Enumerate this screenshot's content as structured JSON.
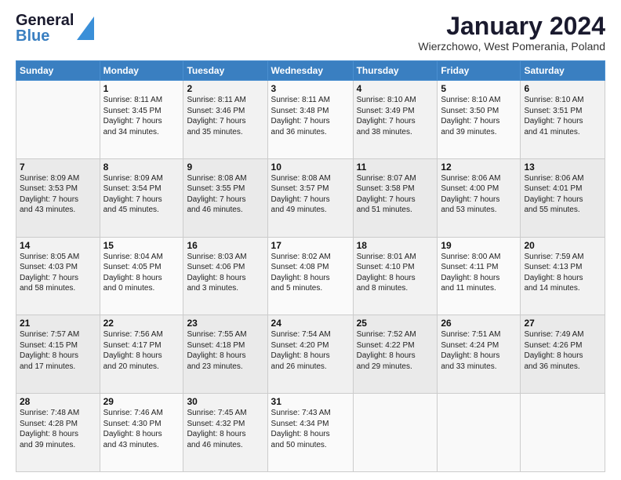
{
  "header": {
    "logo_line1": "General",
    "logo_line2": "Blue",
    "month_title": "January 2024",
    "location": "Wierzchowo, West Pomerania, Poland"
  },
  "weekdays": [
    "Sunday",
    "Monday",
    "Tuesday",
    "Wednesday",
    "Thursday",
    "Friday",
    "Saturday"
  ],
  "weeks": [
    [
      {
        "day": "",
        "info": ""
      },
      {
        "day": "1",
        "info": "Sunrise: 8:11 AM\nSunset: 3:45 PM\nDaylight: 7 hours\nand 34 minutes."
      },
      {
        "day": "2",
        "info": "Sunrise: 8:11 AM\nSunset: 3:46 PM\nDaylight: 7 hours\nand 35 minutes."
      },
      {
        "day": "3",
        "info": "Sunrise: 8:11 AM\nSunset: 3:48 PM\nDaylight: 7 hours\nand 36 minutes."
      },
      {
        "day": "4",
        "info": "Sunrise: 8:10 AM\nSunset: 3:49 PM\nDaylight: 7 hours\nand 38 minutes."
      },
      {
        "day": "5",
        "info": "Sunrise: 8:10 AM\nSunset: 3:50 PM\nDaylight: 7 hours\nand 39 minutes."
      },
      {
        "day": "6",
        "info": "Sunrise: 8:10 AM\nSunset: 3:51 PM\nDaylight: 7 hours\nand 41 minutes."
      }
    ],
    [
      {
        "day": "7",
        "info": "Sunrise: 8:09 AM\nSunset: 3:53 PM\nDaylight: 7 hours\nand 43 minutes."
      },
      {
        "day": "8",
        "info": "Sunrise: 8:09 AM\nSunset: 3:54 PM\nDaylight: 7 hours\nand 45 minutes."
      },
      {
        "day": "9",
        "info": "Sunrise: 8:08 AM\nSunset: 3:55 PM\nDaylight: 7 hours\nand 46 minutes."
      },
      {
        "day": "10",
        "info": "Sunrise: 8:08 AM\nSunset: 3:57 PM\nDaylight: 7 hours\nand 49 minutes."
      },
      {
        "day": "11",
        "info": "Sunrise: 8:07 AM\nSunset: 3:58 PM\nDaylight: 7 hours\nand 51 minutes."
      },
      {
        "day": "12",
        "info": "Sunrise: 8:06 AM\nSunset: 4:00 PM\nDaylight: 7 hours\nand 53 minutes."
      },
      {
        "day": "13",
        "info": "Sunrise: 8:06 AM\nSunset: 4:01 PM\nDaylight: 7 hours\nand 55 minutes."
      }
    ],
    [
      {
        "day": "14",
        "info": "Sunrise: 8:05 AM\nSunset: 4:03 PM\nDaylight: 7 hours\nand 58 minutes."
      },
      {
        "day": "15",
        "info": "Sunrise: 8:04 AM\nSunset: 4:05 PM\nDaylight: 8 hours\nand 0 minutes."
      },
      {
        "day": "16",
        "info": "Sunrise: 8:03 AM\nSunset: 4:06 PM\nDaylight: 8 hours\nand 3 minutes."
      },
      {
        "day": "17",
        "info": "Sunrise: 8:02 AM\nSunset: 4:08 PM\nDaylight: 8 hours\nand 5 minutes."
      },
      {
        "day": "18",
        "info": "Sunrise: 8:01 AM\nSunset: 4:10 PM\nDaylight: 8 hours\nand 8 minutes."
      },
      {
        "day": "19",
        "info": "Sunrise: 8:00 AM\nSunset: 4:11 PM\nDaylight: 8 hours\nand 11 minutes."
      },
      {
        "day": "20",
        "info": "Sunrise: 7:59 AM\nSunset: 4:13 PM\nDaylight: 8 hours\nand 14 minutes."
      }
    ],
    [
      {
        "day": "21",
        "info": "Sunrise: 7:57 AM\nSunset: 4:15 PM\nDaylight: 8 hours\nand 17 minutes."
      },
      {
        "day": "22",
        "info": "Sunrise: 7:56 AM\nSunset: 4:17 PM\nDaylight: 8 hours\nand 20 minutes."
      },
      {
        "day": "23",
        "info": "Sunrise: 7:55 AM\nSunset: 4:18 PM\nDaylight: 8 hours\nand 23 minutes."
      },
      {
        "day": "24",
        "info": "Sunrise: 7:54 AM\nSunset: 4:20 PM\nDaylight: 8 hours\nand 26 minutes."
      },
      {
        "day": "25",
        "info": "Sunrise: 7:52 AM\nSunset: 4:22 PM\nDaylight: 8 hours\nand 29 minutes."
      },
      {
        "day": "26",
        "info": "Sunrise: 7:51 AM\nSunset: 4:24 PM\nDaylight: 8 hours\nand 33 minutes."
      },
      {
        "day": "27",
        "info": "Sunrise: 7:49 AM\nSunset: 4:26 PM\nDaylight: 8 hours\nand 36 minutes."
      }
    ],
    [
      {
        "day": "28",
        "info": "Sunrise: 7:48 AM\nSunset: 4:28 PM\nDaylight: 8 hours\nand 39 minutes."
      },
      {
        "day": "29",
        "info": "Sunrise: 7:46 AM\nSunset: 4:30 PM\nDaylight: 8 hours\nand 43 minutes."
      },
      {
        "day": "30",
        "info": "Sunrise: 7:45 AM\nSunset: 4:32 PM\nDaylight: 8 hours\nand 46 minutes."
      },
      {
        "day": "31",
        "info": "Sunrise: 7:43 AM\nSunset: 4:34 PM\nDaylight: 8 hours\nand 50 minutes."
      },
      {
        "day": "",
        "info": ""
      },
      {
        "day": "",
        "info": ""
      },
      {
        "day": "",
        "info": ""
      }
    ]
  ]
}
